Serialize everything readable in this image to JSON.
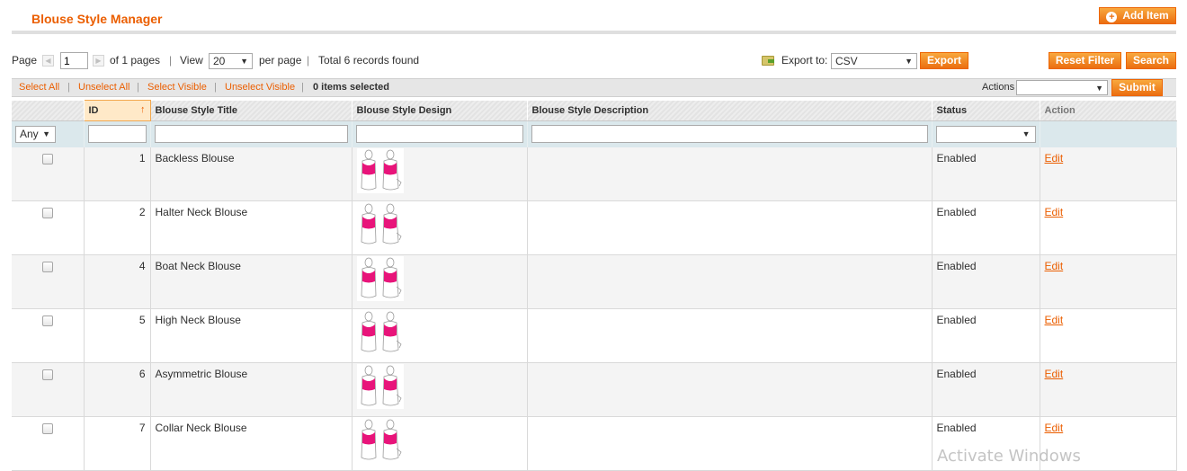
{
  "header": {
    "title": "Blouse Style Manager",
    "add_item_label": "Add Item"
  },
  "pager": {
    "page_label": "Page",
    "page_value": "1",
    "of_pages": "of 1 pages",
    "view_label": "View",
    "per_page_value": "20",
    "per_page_label": "per page",
    "total": "Total 6 records found"
  },
  "export": {
    "label": "Export to:",
    "format": "CSV",
    "button": "Export"
  },
  "filters_actions": {
    "reset_label": "Reset Filter",
    "search_label": "Search"
  },
  "massaction": {
    "select_all": "Select All",
    "unselect_all": "Unselect All",
    "select_visible": "Select Visible",
    "unselect_visible": "Unselect Visible",
    "selected": "0 items selected",
    "actions_label": "Actions",
    "actions_value": "",
    "submit": "Submit"
  },
  "columns": [
    "",
    "ID",
    "Blouse Style Title",
    "Blouse Style Design",
    "Blouse Style Description",
    "Status",
    "Action"
  ],
  "filter": {
    "any": "Any"
  },
  "rows": [
    {
      "id": "1",
      "title": "Backless Blouse",
      "description": "",
      "status": "Enabled",
      "action": "Edit"
    },
    {
      "id": "2",
      "title": "Halter Neck Blouse",
      "description": "",
      "status": "Enabled",
      "action": "Edit"
    },
    {
      "id": "4",
      "title": "Boat Neck Blouse",
      "description": "",
      "status": "Enabled",
      "action": "Edit"
    },
    {
      "id": "5",
      "title": "High Neck Blouse",
      "description": "",
      "status": "Enabled",
      "action": "Edit"
    },
    {
      "id": "6",
      "title": "Asymmetric Blouse",
      "description": "",
      "status": "Enabled",
      "action": "Edit"
    },
    {
      "id": "7",
      "title": "Collar Neck Blouse",
      "description": "",
      "status": "Enabled",
      "action": "Edit"
    }
  ],
  "watermark": "Activate Windows",
  "colors": {
    "accent": "#eb5e00",
    "button": "#f18a20",
    "blouse_pink": "#e8147a",
    "filter_row": "#dbe8ec"
  }
}
